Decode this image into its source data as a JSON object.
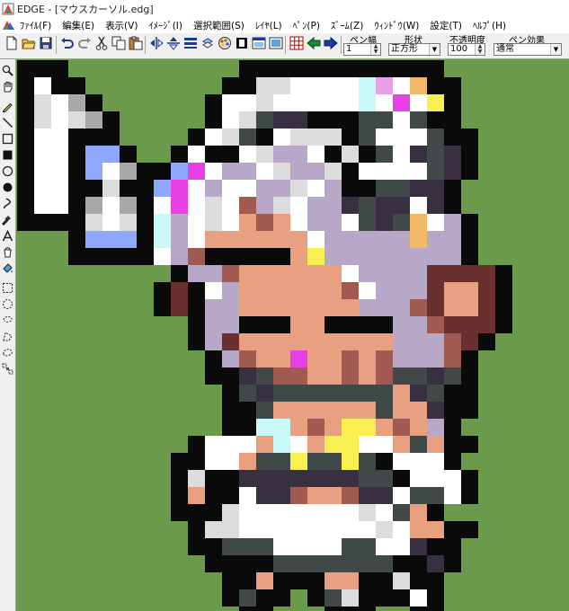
{
  "window": {
    "title": "EDGE - [マウスカーソル.edg]"
  },
  "menu": [
    "ﾌｧｲﾙ(F)",
    "編集(E)",
    "表示(V)",
    "ｲﾒｰｼﾞ(I)",
    "選択範囲(S)",
    "ﾚｲﾔ(L)",
    "ﾍﾟﾝ(P)",
    "ｽﾞｰﾑ(Z)",
    "ｳｨﾝﾄﾞｳ(W)",
    "設定(T)",
    "ﾍﾙﾌﾟ(H)"
  ],
  "controls": {
    "pen_width": {
      "label": "ペン幅",
      "value": "1"
    },
    "shape": {
      "label": "形状",
      "value": "正方形"
    },
    "opacity": {
      "label": "不透明度",
      "value": "100"
    },
    "pen_effect": {
      "label": "ペン効果",
      "value": "通常"
    }
  },
  "colors": {
    "canvas_bg": "#6a9a4a",
    "palette": {
      "K": "#0a0a0a",
      "W": "#ffffff",
      "L": "#dcdcdc",
      "G": "#a8a8a8",
      "B": "#8fa8ff",
      "V": "#b8a8c8",
      "P": "#e840e8",
      "Q": "#e8a0e8",
      "C": "#c8f8f8",
      "Y": "#f8f050",
      "O": "#f0b868",
      "S": "#e8a080",
      "R": "#a05a50",
      "D": "#6a3030",
      "N": "#404848",
      "M": "#383040"
    }
  }
}
